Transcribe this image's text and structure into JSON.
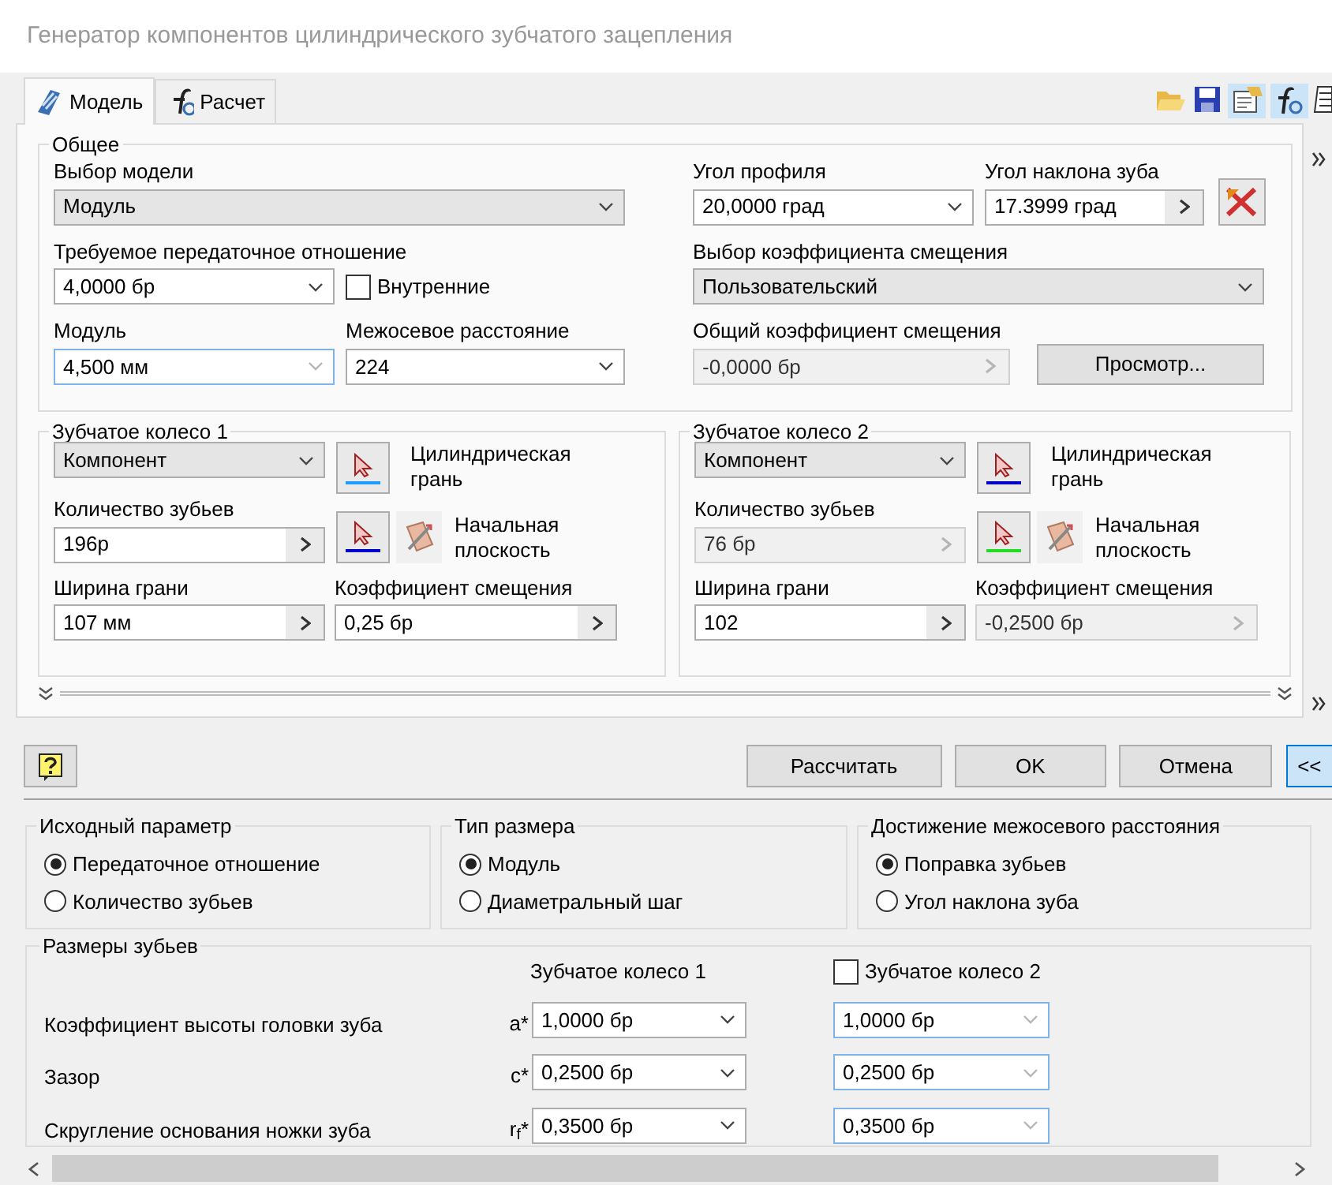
{
  "window": {
    "title": "Генератор компонентов цилиндрического зубчатого зацепления"
  },
  "tabs": [
    {
      "label": "Модель",
      "selected": true,
      "kind": "model"
    },
    {
      "label": "Расчет",
      "selected": false,
      "kind": "calc"
    }
  ],
  "general": {
    "title": "Общее",
    "left": [
      {
        "kind": "list",
        "label": "Выбор модели",
        "value": "Модуль",
        "disabled": false,
        "focused": false
      },
      {
        "kind": "combo",
        "label": "Требуемое передаточное отношение",
        "value": "4,0000 бр",
        "disabled": false,
        "focused": false
      },
      {
        "kind": "checkbox",
        "label": "Внутренние",
        "checked": false
      },
      {
        "kind": "combo",
        "label": "Модуль",
        "value": "4,500 мм",
        "disabled": false,
        "focused": true
      },
      {
        "kind": "combo",
        "label": "Межосевое расстояние",
        "value": "224",
        "disabled": false,
        "focused": false
      }
    ],
    "right": [
      {
        "kind": "combo",
        "label": "Угол профиля",
        "value": "20,0000 град",
        "disabled": false,
        "focused": false
      },
      {
        "kind": "spin",
        "label": "Угол наклона зуба",
        "value": "17.3999 град",
        "disabled": false,
        "focused": false
      },
      {
        "kind": "icon_button"
      },
      {
        "kind": "list",
        "label": "Выбор коэффициента смещения",
        "value": "Пользовательский",
        "disabled": false,
        "focused": false
      },
      {
        "kind": "spin",
        "label": "Общий коэффициент смещения",
        "value": "-0,0000 бр",
        "disabled": true,
        "focused": false
      },
      {
        "kind": "button",
        "label": "Просмотр..."
      }
    ]
  },
  "gears": [
    {
      "title": "Зубчатое колесо 1",
      "source": "Компонент",
      "face": {
        "label": "Цилиндрическая грань",
        "color": "#1e9bff"
      },
      "teeth": {
        "label": "Количество зубьев",
        "value": "196р",
        "disabled": false
      },
      "plane": {
        "label": "Начальная плоскость",
        "color": "#0000cc"
      },
      "width": {
        "label": "Ширина грани",
        "value": "107 мм",
        "disabled": false
      },
      "shift": {
        "label": "Коэффициент смещения",
        "value": "0,25 бр",
        "disabled": false
      }
    },
    {
      "title": "Зубчатое колесо 2",
      "source": "Компонент",
      "face": {
        "label": "Цилиндрическая грань",
        "color": "#0000cc"
      },
      "teeth": {
        "label": "Количество зубьев",
        "value": "76 бр",
        "disabled": true
      },
      "plane": {
        "label": "Начальная плоскость",
        "color": "#22dd22"
      },
      "width": {
        "label": "Ширина грани",
        "value": "102",
        "disabled": false
      },
      "shift": {
        "label": "Коэффициент смещения",
        "value": "-0,2500 бр",
        "disabled": true
      }
    }
  ],
  "actions": [
    {
      "label": "Рассчитать",
      "pressed": false
    },
    {
      "label": "OK",
      "pressed": false
    },
    {
      "label": "Отмена",
      "pressed": false
    },
    {
      "label": "<<",
      "pressed": true
    }
  ],
  "option_groups": [
    {
      "title": "Исходный параметр",
      "options": [
        {
          "label": "Передаточное отношение",
          "selected": true
        },
        {
          "label": "Количество зубьев",
          "selected": false
        }
      ]
    },
    {
      "title": "Тип размера",
      "options": [
        {
          "label": "Модуль",
          "selected": true
        },
        {
          "label": "Диаметральный шаг",
          "selected": false
        }
      ]
    },
    {
      "title": "Достижение межосевого расстояния",
      "options": [
        {
          "label": "Поправка зубьев",
          "selected": true
        },
        {
          "label": "Угол наклона зуба",
          "selected": false
        }
      ]
    }
  ],
  "tooth_sizes": {
    "title": "Размеры зубьев",
    "column_1": "Зубчатое колесо 1",
    "column_2": {
      "label": "Зубчатое колесо 2",
      "checked": false
    },
    "rows": [
      {
        "label": "Коэффициент высоты головки зуба",
        "symbol": "a*",
        "value_1": {
          "value": "1,0000 бр",
          "focused": false
        },
        "value_2": {
          "value": "1,0000 бр",
          "focused": true
        }
      },
      {
        "label": "Зазор",
        "symbol": "c*",
        "value_1": {
          "value": "0,2500 бр",
          "focused": false
        },
        "value_2": {
          "value": "0,2500 бр",
          "focused": true
        }
      },
      {
        "label": "Скругление основания ножки зуба",
        "symbol": "r$_{f}$*",
        "value_1": {
          "value": "0,3500 бр",
          "focused": false
        },
        "value_2": {
          "value": "0,3500 бр",
          "focused": true
        }
      }
    ]
  }
}
